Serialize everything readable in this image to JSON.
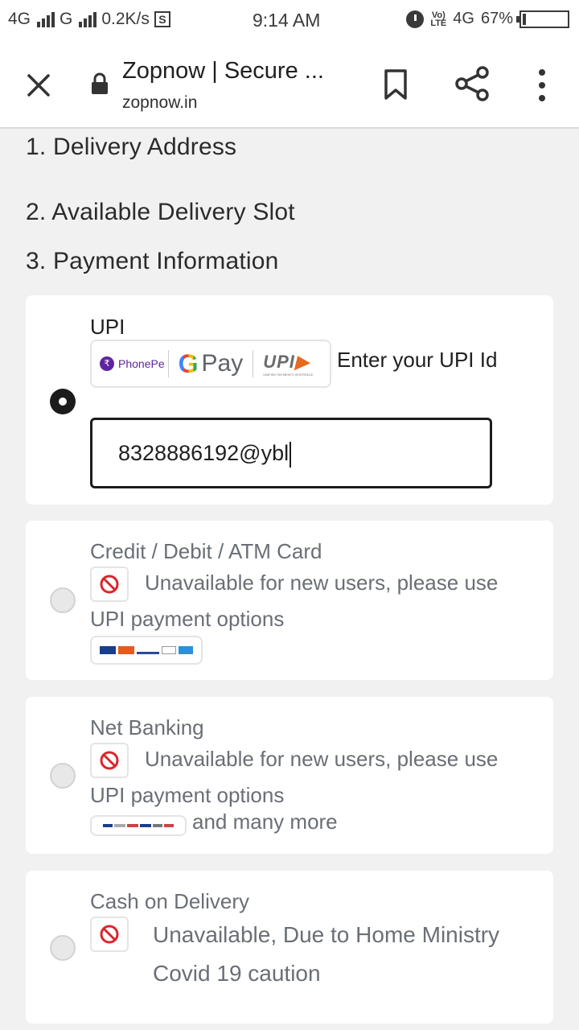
{
  "status_bar": {
    "network1": "4G",
    "network2": "G",
    "speed": "0.2K/s",
    "time": "9:14 AM",
    "network3": "4G",
    "battery": "67%",
    "battery_level": 0.67
  },
  "browser": {
    "title": "Zopnow | Secure ...",
    "url": "zopnow.in"
  },
  "steps": {
    "step1": "1. Delivery Address",
    "step2": "2. Available Delivery Slot",
    "step3": "3. Payment Information"
  },
  "payment": {
    "upi": {
      "label": "UPI",
      "logos": [
        "PhonePe",
        "G Pay",
        "UPI"
      ],
      "hint": "Enter your UPI Id",
      "value": "8328886192@ybl",
      "selected": true
    },
    "card": {
      "label": "Credit / Debit / ATM Card",
      "note_line1": "Unavailable for new users, please use",
      "note_line2": "UPI payment options",
      "selected": false
    },
    "netbanking": {
      "label": "Net Banking",
      "note_line1": "Unavailable for new users, please use",
      "note_line2": "UPI payment options",
      "more": "and many more",
      "selected": false
    },
    "cod": {
      "label": "Cash on Delivery",
      "note_line1": "Unavailable, Due to Home Ministry",
      "note_line2": "Covid 19 caution",
      "selected": false
    }
  },
  "colors": {
    "page_bg": "#f1f1f1",
    "card_bg": "#ffffff",
    "block_red": "#d9262c",
    "phonepe_purple": "#5f259f"
  }
}
